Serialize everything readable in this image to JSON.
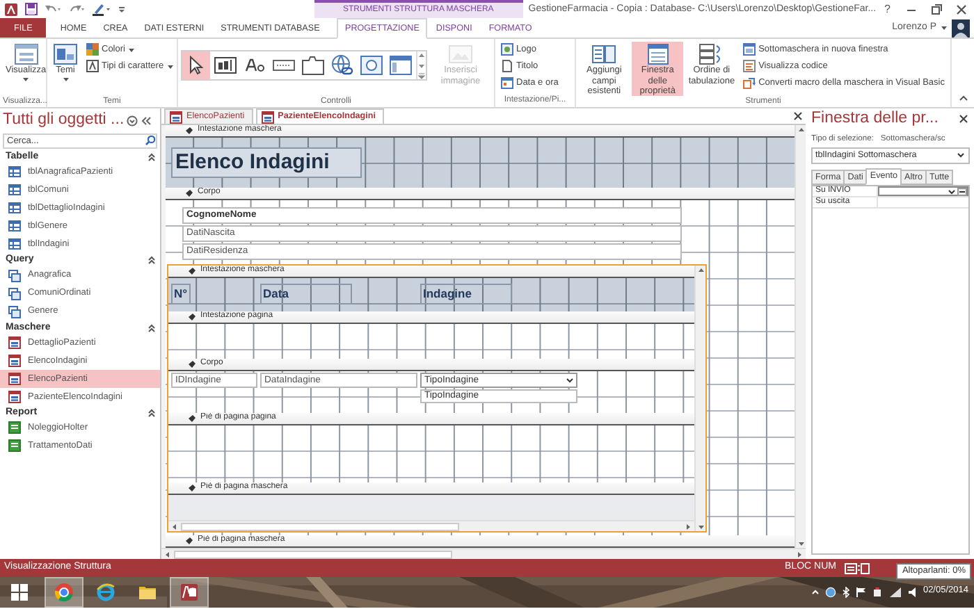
{
  "window": {
    "context_group": "STRUMENTI STRUTTURA MASCHERA",
    "title": "GestioneFarmacia - Copia : Database- C:\\Users\\Lorenzo\\Desktop\\GestioneFar...",
    "help": "?",
    "user": "Lorenzo P"
  },
  "ribbon_tabs": [
    {
      "label": "FILE",
      "kind": "file",
      "selected": false
    },
    {
      "label": "HOME",
      "kind": "tab",
      "selected": false
    },
    {
      "label": "CREA",
      "kind": "tab",
      "selected": false
    },
    {
      "label": "DATI ESTERNI",
      "kind": "tab",
      "selected": false
    },
    {
      "label": "STRUMENTI DATABASE",
      "kind": "tab",
      "selected": false
    },
    {
      "label": "PROGETTAZIONE",
      "kind": "context",
      "selected": true
    },
    {
      "label": "DISPONI",
      "kind": "context",
      "selected": false
    },
    {
      "label": "FORMATO",
      "kind": "context",
      "selected": false
    }
  ],
  "ribbon_groups": [
    {
      "label": "Visualizza...",
      "items": [
        {
          "kind": "large",
          "label": "Visualizza",
          "dropdown": true,
          "selected": false
        }
      ]
    },
    {
      "label": "Temi",
      "items": [
        {
          "kind": "large",
          "label": "Temi",
          "dropdown": true,
          "selected": false
        },
        {
          "kind": "small",
          "label": "Colori",
          "dropdown": true,
          "selected": false
        },
        {
          "kind": "small",
          "label": "Tipi di carattere",
          "dropdown": true,
          "selected": false
        }
      ]
    },
    {
      "label": "Controlli",
      "items": [
        {
          "kind": "gallery",
          "tools": [
            {
              "selected": true
            },
            {
              "selected": false
            },
            {
              "selected": false
            },
            {
              "selected": false
            },
            {
              "selected": false
            },
            {
              "selected": false
            },
            {
              "selected": false
            },
            {
              "selected": false
            }
          ],
          "disabled": false
        },
        {
          "kind": "large",
          "label": "Inserisci immagine",
          "dropdown": false,
          "selected": false,
          "disabled": true
        }
      ]
    },
    {
      "label": "Intestazione/Pi...",
      "items": [
        {
          "kind": "small",
          "label": "Logo",
          "dropdown": false,
          "selected": false
        },
        {
          "kind": "small",
          "label": "Titolo",
          "dropdown": false,
          "selected": false
        },
        {
          "kind": "small",
          "label": "Data e ora",
          "dropdown": false,
          "selected": false
        }
      ]
    },
    {
      "label": "Strumenti",
      "items": [
        {
          "kind": "large",
          "label": "Aggiungi campi esistenti",
          "dropdown": false,
          "selected": false
        },
        {
          "kind": "large",
          "label": "Finestra delle proprietà",
          "dropdown": false,
          "selected": true
        },
        {
          "kind": "large",
          "label": "Ordine di tabulazione",
          "dropdown": false,
          "selected": false
        },
        {
          "kind": "small",
          "label": "Sottomaschera in nuova finestra",
          "dropdown": false,
          "selected": false
        },
        {
          "kind": "small",
          "label": "Visualizza codice",
          "dropdown": false,
          "selected": false
        },
        {
          "kind": "small",
          "label": "Converti macro della maschera in Visual Basic",
          "dropdown": false,
          "selected": false
        }
      ]
    }
  ],
  "navigation": {
    "title": "Tutti gli oggetti ...",
    "search_placeholder": "Cerca...",
    "groups": [
      {
        "label": "Tabelle",
        "kind": "table",
        "expanded": true,
        "items": [
          {
            "label": "tblAnagraficaPazienti",
            "selected": false
          },
          {
            "label": "tblComuni",
            "selected": false
          },
          {
            "label": "tblDettaglioIndagini",
            "selected": false
          },
          {
            "label": "tblGenere",
            "selected": false
          },
          {
            "label": "tblIndagini",
            "selected": false
          }
        ]
      },
      {
        "label": "Query",
        "kind": "query",
        "expanded": true,
        "items": [
          {
            "label": "Anagrafica",
            "selected": false
          },
          {
            "label": "ComuniOrdinati",
            "selected": false
          },
          {
            "label": "Genere",
            "selected": false
          }
        ]
      },
      {
        "label": "Maschere",
        "kind": "form",
        "expanded": true,
        "items": [
          {
            "label": "DettaglioPazienti",
            "selected": false
          },
          {
            "label": "ElencoIndagini",
            "selected": false
          },
          {
            "label": "ElencoPazienti",
            "selected": true
          },
          {
            "label": "PazienteElencoIndagini",
            "selected": false
          }
        ]
      },
      {
        "label": "Report",
        "kind": "report",
        "expanded": true,
        "items": [
          {
            "label": "NoleggioHolter",
            "selected": false
          },
          {
            "label": "TrattamentoDati",
            "selected": false
          }
        ]
      }
    ]
  },
  "document_tabs": [
    {
      "label": "ElencoPazienti",
      "selected": false
    },
    {
      "label": "PazienteElencoIndagini",
      "selected": true
    }
  ],
  "design": {
    "sections": [
      {
        "label": "Intestazione maschera",
        "kind": "header",
        "controls": [
          {
            "kind": "title",
            "text": "Elenco Indagini"
          }
        ]
      },
      {
        "label": "Corpo",
        "kind": "detail",
        "controls": [
          {
            "kind": "field",
            "text": "CognomeNome",
            "bold": true
          },
          {
            "kind": "field",
            "text": "DatiNascita",
            "bold": false
          },
          {
            "kind": "field",
            "text": "DatiResidenza",
            "bold": false
          },
          {
            "kind": "subform",
            "selected": true,
            "sections": [
              {
                "label": "Intestazione maschera",
                "kind": "header",
                "controls": [
                  {
                    "kind": "label",
                    "text": "N°"
                  },
                  {
                    "kind": "label",
                    "text": "Data"
                  },
                  {
                    "kind": "label",
                    "text": "Indagine"
                  }
                ]
              },
              {
                "label": "Intestazione pagina",
                "kind": "page"
              },
              {
                "label": "Corpo",
                "kind": "detail",
                "controls": [
                  {
                    "kind": "field",
                    "text": "IDIndagine",
                    "bold": false
                  },
                  {
                    "kind": "field",
                    "text": "DataIndagine",
                    "bold": false
                  },
                  {
                    "kind": "combo",
                    "text": "TipoIndagine",
                    "expanded": true,
                    "options": [
                      "TipoIndagine"
                    ]
                  }
                ]
              },
              {
                "label": "Piè di pagina pagina",
                "kind": "page"
              },
              {
                "label": "Piè di pagina maschera",
                "kind": "footer"
              }
            ]
          }
        ]
      },
      {
        "label": "Piè di pagina maschera",
        "kind": "footer"
      }
    ]
  },
  "property_sheet": {
    "title": "Finestra delle pr...",
    "selection_type_label": "Tipo di selezione:",
    "selection_type": "Sottomaschera/sc",
    "object": "tblIndagini Sottomaschera",
    "tabs": [
      {
        "label": "Forma",
        "selected": false
      },
      {
        "label": "Dati",
        "selected": false
      },
      {
        "label": "Evento",
        "selected": true
      },
      {
        "label": "Altro",
        "selected": false
      },
      {
        "label": "Tutte",
        "selected": false
      }
    ],
    "properties": [
      {
        "name": "Su INVIO",
        "selected": true
      },
      {
        "name": "Su uscita",
        "selected": false
      }
    ]
  },
  "status_bar": {
    "text": "Visualizzazione Struttura",
    "indicator": "BLOC NUM",
    "tooltip": "Altoparlanti: 0%"
  },
  "taskbar": {
    "apps": [
      {
        "kind": "chrome",
        "running": true
      },
      {
        "kind": "browser",
        "running": false
      },
      {
        "kind": "folder",
        "running": false
      },
      {
        "kind": "database",
        "running": true
      }
    ],
    "date": "02/05/2014"
  }
}
